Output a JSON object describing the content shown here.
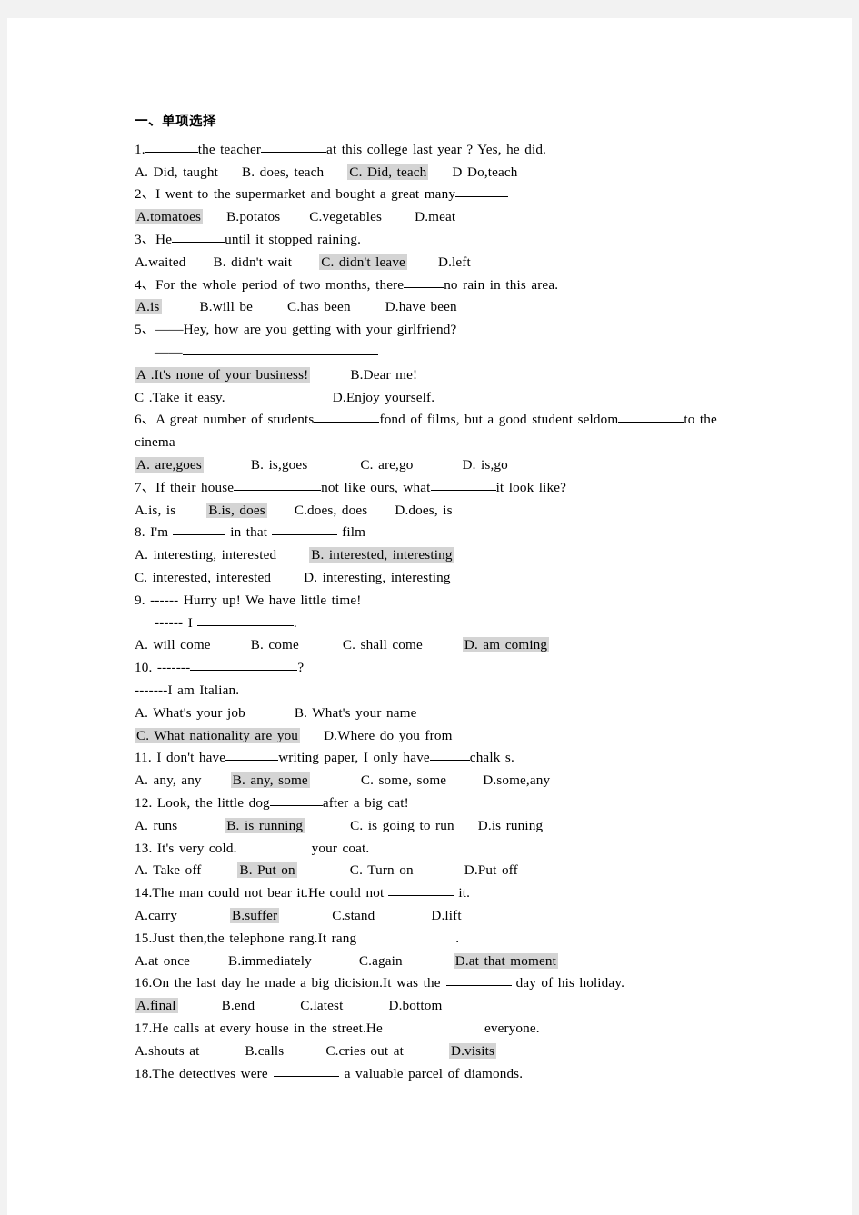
{
  "document": {
    "section_heading": "一、单项选择",
    "page_background": "#f2f2f2",
    "sheet_background": "#ffffff",
    "highlight_color": "#d4d4d4"
  },
  "questions": [
    {
      "number": "1.",
      "stem_before": "1.",
      "stem_mid": "the teacher",
      "stem_after": "at this college last year ? Yes, he did.",
      "options_line": "A. Did, taught",
      "opt_a": "A. Did, taught",
      "opt_b": "B. does, teach",
      "opt_c": "C. Did, teach",
      "opt_d": "D Do,teach",
      "answer": "C"
    },
    {
      "number": "2、",
      "stem": "2、I went to the supermarket and bought a great many",
      "opt_a": "A.tomatoes",
      "opt_b": "B.potatos",
      "opt_c": "C.vegetables",
      "opt_d": "D.meat",
      "answer": "A"
    },
    {
      "number": "3、",
      "stem_before": "3、He",
      "stem_after": "until it stopped raining.",
      "opt_a": "A.waited",
      "opt_b": "B. didn't wait",
      "opt_c": "C. didn't leave",
      "opt_d": "D.left",
      "answer": "C"
    },
    {
      "number": "4、",
      "stem_before": "4、For the whole period of two months, there",
      "stem_after": "no rain in this area.",
      "opt_a": "A.is",
      "opt_b": "B.will be",
      "opt_c": "C.has been",
      "opt_d": "D.have been",
      "answer": "A"
    },
    {
      "number": "5、",
      "stem": "5、——Hey, how are you getting with your girlfriend?",
      "reply_dash": "——",
      "opt_a": "A .It's none of your business!",
      "opt_b": "B.Dear me!",
      "opt_c": "C .Take it easy.",
      "opt_d": "D.Enjoy yourself.",
      "answer": "A"
    },
    {
      "number": "6、",
      "stem_before": "6、A great number of students",
      "stem_mid": "fond of films, but a good student seldom",
      "stem_after": "to the",
      "stem_wrap": "cinema",
      "opt_a": "A. are,goes",
      "opt_b": "B. is,goes",
      "opt_c": "C. are,go",
      "opt_d": "D. is,go",
      "answer": "A"
    },
    {
      "number": "7、",
      "stem_before": "7、If their house",
      "stem_mid": "not like ours, what",
      "stem_after": "it look like?",
      "opt_a": "A.is, is",
      "opt_b": "B.is, does",
      "opt_c": "C.does, does",
      "opt_d": "D.does, is",
      "answer": "B"
    },
    {
      "number": "8.",
      "stem_before": "8. I'm",
      "stem_mid": "in that",
      "stem_after": "film",
      "opt_a": "A. interesting, interested",
      "opt_b": "B. interested, interesting",
      "opt_c": "C. interested, interested",
      "opt_d": "D. interesting, interesting",
      "answer": "B"
    },
    {
      "number": "9.",
      "stem": "9. ------ Hurry up! We have little time!",
      "reply_before": "------ I",
      "reply_after": ".",
      "opt_a": "A. will come",
      "opt_b": "B. come",
      "opt_c": "C. shall come",
      "opt_d": "D. am coming",
      "answer": "D"
    },
    {
      "number": "10.",
      "stem_before": "10. -------",
      "stem_after": "?",
      "reply": "-------I am Italian.",
      "opt_a": "A. What's your job",
      "opt_b": "B. What's your name",
      "opt_c": "C. What nationality are you",
      "opt_d": "D.Where do you from",
      "answer": "C"
    },
    {
      "number": "11.",
      "stem_before": "11. I don't have",
      "stem_mid": "writing paper, I only have",
      "stem_after": "chalk s.",
      "opt_a": "A. any, any",
      "opt_b": "B. any, some",
      "opt_c": "C. some, some",
      "opt_d": "D.some,any",
      "answer": "B"
    },
    {
      "number": "12.",
      "stem_before": "12. Look, the little dog",
      "stem_after": "after a big cat!",
      "opt_a": "A. runs",
      "opt_b": "B. is running",
      "opt_c": "C. is going to run",
      "opt_d": "D.is runing",
      "answer": "B"
    },
    {
      "number": "13.",
      "stem_before": "13. It's very cold.",
      "stem_after": "your coat.",
      "opt_a": "A. Take off",
      "opt_b": "B. Put on",
      "opt_c": "C. Turn on",
      "opt_d": "D.Put off",
      "answer": "B"
    },
    {
      "number": "14.",
      "stem_before": "14.The man could not bear it.He could not",
      "stem_after": "it.",
      "opt_a": "A.carry",
      "opt_b": "B.suffer",
      "opt_c": "C.stand",
      "opt_d": "D.lift",
      "answer": "B"
    },
    {
      "number": "15.",
      "stem_before": "15.Just then,the telephone rang.It rang",
      "stem_after": ".",
      "opt_a": "A.at once",
      "opt_b": "B.immediately",
      "opt_c": "C.again",
      "opt_d": "D.at that moment",
      "answer": "D"
    },
    {
      "number": "16.",
      "stem_before": "16.On the last day he made a big dicision.It was the",
      "stem_after": "day of his holiday.",
      "opt_a": "A.final",
      "opt_b": "B.end",
      "opt_c": "C.latest",
      "opt_d": "D.bottom",
      "answer": "A"
    },
    {
      "number": "17.",
      "stem_before": "17.He calls at every house in the street.He",
      "stem_after": "everyone.",
      "opt_a": "A.shouts at",
      "opt_b": "B.calls",
      "opt_c": "C.cries out at",
      "opt_d": "D.visits",
      "answer": "D"
    },
    {
      "number": "18.",
      "stem_before": "18.The detectives were",
      "stem_after": "a valuable parcel of diamonds.",
      "opt_a": "",
      "opt_b": "",
      "opt_c": "",
      "opt_d": "",
      "answer": ""
    }
  ]
}
